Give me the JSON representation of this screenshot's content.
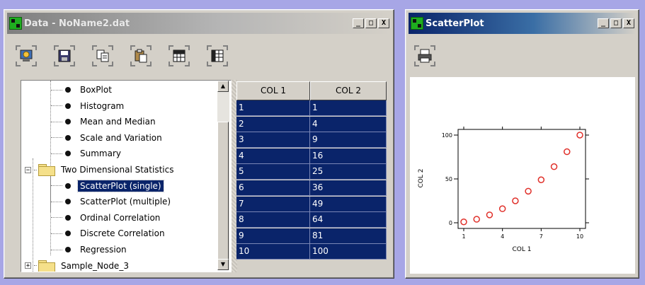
{
  "data_window": {
    "title": "Data - NoName2.dat",
    "controls": [
      "_",
      "□",
      "X"
    ],
    "toolbar": [
      {
        "icon": "import-data-icon"
      },
      {
        "icon": "save-icon"
      },
      {
        "icon": "copy-icon"
      },
      {
        "icon": "paste-icon"
      },
      {
        "icon": "grid-icon"
      },
      {
        "icon": "grid-icon"
      }
    ],
    "tree": [
      {
        "label": "BoxPlot",
        "type": "leaf"
      },
      {
        "label": "Histogram",
        "type": "leaf"
      },
      {
        "label": "Mean and Median",
        "type": "leaf"
      },
      {
        "label": "Scale and Variation",
        "type": "leaf"
      },
      {
        "label": "Summary",
        "type": "leaf"
      },
      {
        "label": "Two Dimensional Statistics",
        "type": "folder",
        "expander": "−"
      },
      {
        "label": "ScatterPlot (single)",
        "type": "leaf",
        "selected": true
      },
      {
        "label": "ScatterPlot (multiple)",
        "type": "leaf"
      },
      {
        "label": "Ordinal Correlation",
        "type": "leaf"
      },
      {
        "label": "Discrete Correlation",
        "type": "leaf"
      },
      {
        "label": "Regression",
        "type": "leaf"
      },
      {
        "label": "Sample_Node_3",
        "type": "folder",
        "expander": "+"
      }
    ],
    "table": {
      "columns": [
        "COL 1",
        "COL 2"
      ],
      "rows": [
        [
          "1",
          "1"
        ],
        [
          "2",
          "4"
        ],
        [
          "3",
          "9"
        ],
        [
          "4",
          "16"
        ],
        [
          "5",
          "25"
        ],
        [
          "6",
          "36"
        ],
        [
          "7",
          "49"
        ],
        [
          "8",
          "64"
        ],
        [
          "9",
          "81"
        ],
        [
          "10",
          "100"
        ]
      ]
    }
  },
  "plot_window": {
    "title": "ScatterPlot",
    "controls": [
      "_",
      "□",
      "X"
    ],
    "toolbar": [
      {
        "icon": "print-icon"
      }
    ]
  },
  "chart_data": {
    "type": "scatter",
    "x": [
      1,
      2,
      3,
      4,
      5,
      6,
      7,
      8,
      9,
      10
    ],
    "y": [
      1,
      4,
      9,
      16,
      25,
      36,
      49,
      64,
      81,
      100
    ],
    "xlabel": "COL 1",
    "ylabel": "COL 2",
    "xticks": [
      1,
      4,
      7,
      10
    ],
    "yticks": [
      0,
      50,
      100
    ],
    "xlim": [
      1,
      10
    ],
    "ylim": [
      0,
      100
    ],
    "marker_color": "#e0302a",
    "grid": false
  }
}
